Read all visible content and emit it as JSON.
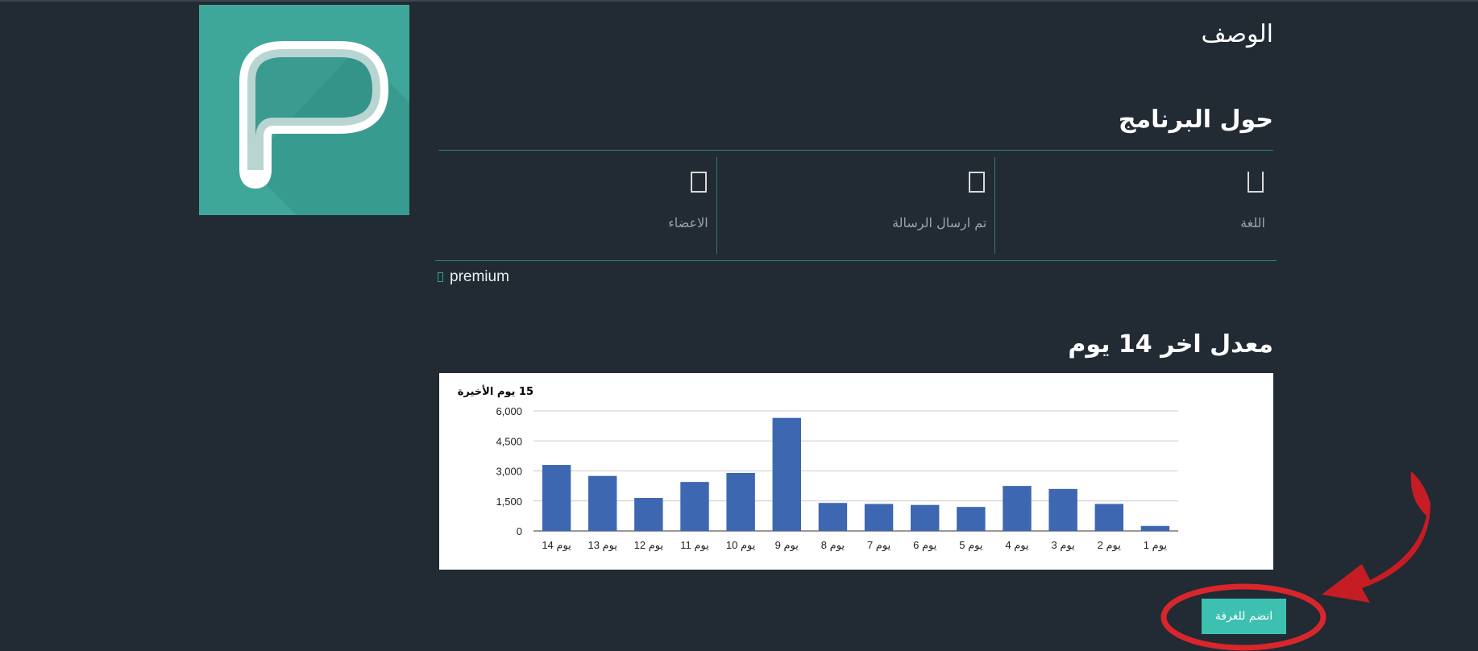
{
  "header": {
    "description_title": "الوصف",
    "about_title": "حول البرنامج"
  },
  "stats": [
    {
      "label": "اللغة",
      "icon": "empty-box-icon"
    },
    {
      "label": "تم ارسال الرسالة",
      "icon": "empty-box-icon"
    },
    {
      "label": "الاعضاء",
      "icon": "empty-box-icon"
    }
  ],
  "premium": {
    "label": "premium",
    "icon": "square-icon"
  },
  "rate_title": "معدل اخر 14 يوم",
  "chart_data": {
    "type": "bar",
    "title": "15 يوم الأخيرة",
    "categories": [
      "يوم 14",
      "يوم 13",
      "يوم 12",
      "يوم 11",
      "يوم 10",
      "يوم 9",
      "يوم 8",
      "يوم 7",
      "يوم 6",
      "يوم 5",
      "يوم 4",
      "يوم 3",
      "يوم 2",
      "يوم 1"
    ],
    "values": [
      3300,
      2750,
      1650,
      2450,
      2900,
      5650,
      1400,
      1350,
      1300,
      1200,
      2250,
      2100,
      1350,
      250
    ],
    "ylim": [
      0,
      6000
    ],
    "yticks": [
      "0",
      "1,500",
      "3,000",
      "4,500",
      "6,000"
    ],
    "ytick_values": [
      0,
      1500,
      3000,
      4500,
      6000
    ],
    "bar_color": "#3d67b1",
    "grid": true
  },
  "join_button": {
    "label": "انضم للغرفة"
  },
  "colors": {
    "background": "#222a33",
    "accent": "#3ec0b0",
    "logo_bg": "#3fa79a",
    "annotation": "#d9262c"
  }
}
